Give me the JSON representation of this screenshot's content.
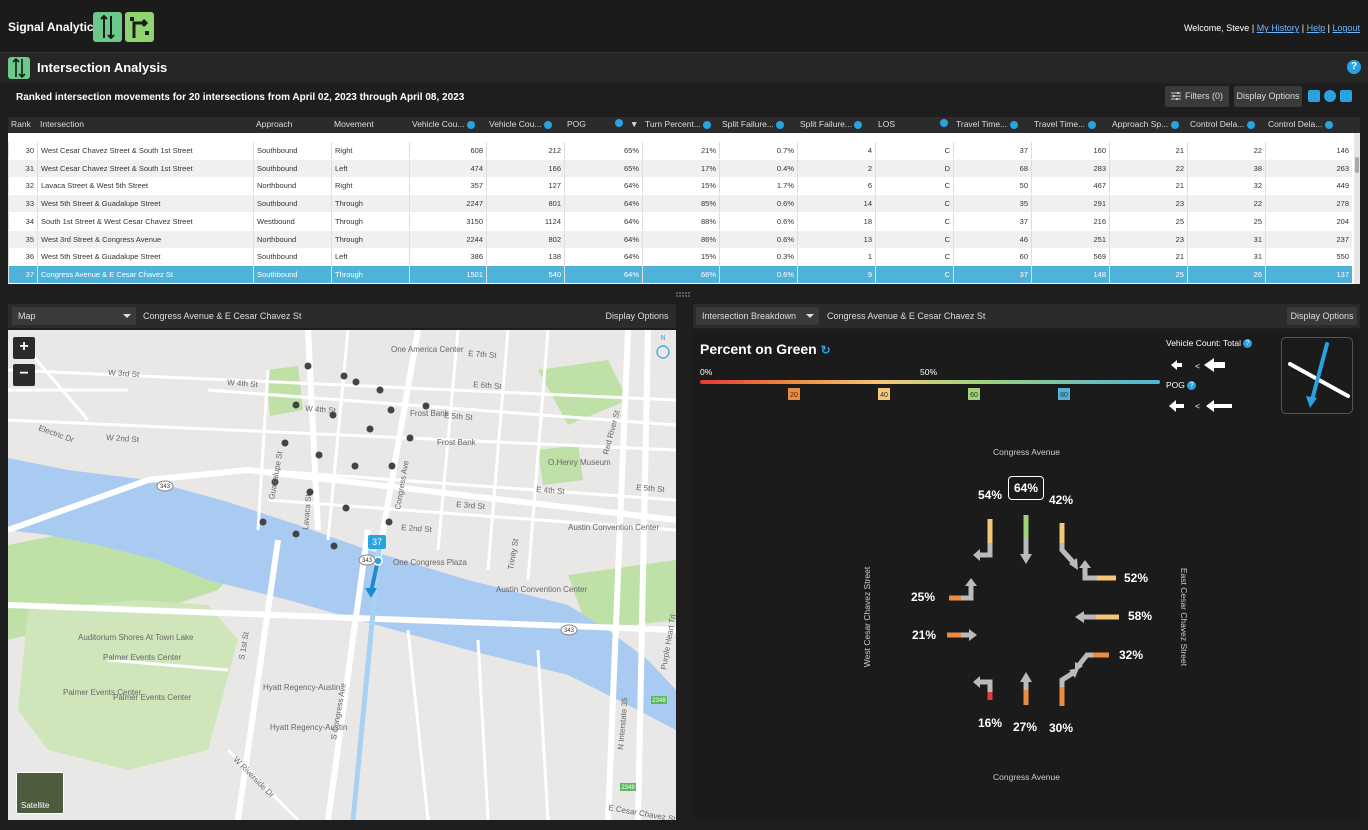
{
  "app": {
    "name": "Signal Analytics",
    "welcome": "Welcome, Steve",
    "links": [
      "My History",
      "Help",
      "Logout"
    ],
    "separator": "|"
  },
  "page": {
    "title": "Intersection Analysis",
    "help": "?",
    "summary": "Ranked intersection movements for 20 intersections from April 02, 2023 through April 08, 2023",
    "filters_label": "Filters (0)",
    "display_options_label": "Display Options"
  },
  "grid": {
    "columns": [
      "Rank",
      "Intersection",
      "Approach",
      "Movement",
      "Vehicle Cou...",
      "Vehicle Cou...",
      "POG",
      "Turn Percent...",
      "Split Failure...",
      "Split Failure...",
      "LOS",
      "Travel Time...",
      "Travel Time...",
      "Approach Sp...",
      "Control Dela...",
      "Control Dela..."
    ],
    "sort_indicator": "▼",
    "rows": [
      [
        "30",
        "West Cesar Chavez Street & South 1st Street",
        "Southbound",
        "Right",
        "608",
        "212",
        "65%",
        "21%",
        "0.7%",
        "4",
        "C",
        "37",
        "160",
        "21",
        "22",
        "146"
      ],
      [
        "31",
        "West Cesar Chavez Street & South 1st Street",
        "Southbound",
        "Left",
        "474",
        "166",
        "65%",
        "17%",
        "0.4%",
        "2",
        "D",
        "68",
        "283",
        "22",
        "38",
        "263"
      ],
      [
        "32",
        "Lavaca Street & West 5th Street",
        "Northbound",
        "Right",
        "357",
        "127",
        "64%",
        "15%",
        "1.7%",
        "6",
        "C",
        "50",
        "467",
        "21",
        "32",
        "449"
      ],
      [
        "33",
        "West 5th Street & Guadalupe Street",
        "Southbound",
        "Through",
        "2247",
        "801",
        "64%",
        "85%",
        "0.6%",
        "14",
        "C",
        "35",
        "291",
        "23",
        "22",
        "278"
      ],
      [
        "34",
        "South 1st Street & West Cesar Chavez Street",
        "Westbound",
        "Through",
        "3150",
        "1124",
        "64%",
        "88%",
        "0.6%",
        "18",
        "C",
        "37",
        "216",
        "25",
        "25",
        "204"
      ],
      [
        "35",
        "West 3rd Street & Congress Avenue",
        "Northbound",
        "Through",
        "2244",
        "802",
        "64%",
        "86%",
        "0.6%",
        "13",
        "C",
        "46",
        "251",
        "23",
        "31",
        "237"
      ],
      [
        "36",
        "West 5th Street & Guadalupe Street",
        "Southbound",
        "Left",
        "386",
        "138",
        "64%",
        "15%",
        "0.3%",
        "1",
        "C",
        "60",
        "569",
        "21",
        "31",
        "550"
      ],
      [
        "37",
        "Congress Avenue & E Cesar Chavez St",
        "Southbound",
        "Through",
        "1501",
        "540",
        "64%",
        "66%",
        "0.6%",
        "9",
        "C",
        "37",
        "148",
        "25",
        "26",
        "137"
      ]
    ],
    "selected_row_index": 7
  },
  "map_panel": {
    "view_select": "Map",
    "title": "Congress Avenue & E Cesar Chavez St",
    "display_options": "Display Options",
    "zoom_in": "+",
    "zoom_out": "−",
    "satellite": "Satellite",
    "marker_label": "37",
    "labels": {
      "one_america": "One America Center",
      "w3rd": "W 3rd St",
      "w4th": "W 4th St",
      "w4th2": "W 4th St",
      "e7th": "E 7th St",
      "e6th": "E 6th St",
      "e5th": "E 5th St",
      "e5th2": "E 5th St",
      "e4th": "E 4th St",
      "e3rd": "E 3rd St",
      "e2nd": "E 2nd St",
      "w2nd": "W 2nd St",
      "electric": "Electric Dr",
      "frost": "Frost Bank",
      "frost2": "Frost Bank",
      "ohenry": "O.Henry Museum",
      "redriver": "Red River St",
      "austin_conv": "Austin Convention Center",
      "austin_conv2": "Austin Convention Center",
      "one_congress": "One Congress Plaza",
      "trinity": "Trinity St",
      "congress": "Congress Ave",
      "s_congress": "S Congress Ave",
      "lavaca": "Lavaca St",
      "guadalupe": "Guadalupe St",
      "s1st": "S 1st St",
      "auditorium": "Auditorium Shores At Town Lake",
      "palmer": "Palmer Events Center",
      "palmer2": "Palmer Events Center",
      "palmer3": "Palmer Events Center",
      "hyatt": "Hyatt Regency-Austin",
      "hyatt2": "Hyatt Regency-Austin",
      "riverside": "W Riverside Dr",
      "interstate": "N Interstate 35",
      "purple_heart": "Purple Heart Trl",
      "e_cesar": "E Cesar Chavez St",
      "shield343a": "343",
      "shield343b": "343",
      "shield343c": "343",
      "shield2348a": "2348",
      "shield2348b": "2348",
      "n_label": "N"
    }
  },
  "breakdown_panel": {
    "view_select": "Intersection Breakdown",
    "title": "Congress Avenue & E Cesar Chavez St",
    "display_options": "Display Options",
    "metric_title": "Percent on Green",
    "scale_start": "0%",
    "scale_mid": "50%",
    "scale_ticks": [
      "20",
      "40",
      "60",
      "80"
    ],
    "vehicle_count_label": "Vehicle Count: Total",
    "pog_label": "POG",
    "less_than": "<",
    "street_north": "Congress Avenue",
    "street_south": "Congress Avenue",
    "street_west": "West Cesar Chavez Street",
    "street_east": "East Cesar Chavez Street",
    "pcts": {
      "sb_right": "54%",
      "sb_through": "64%",
      "sb_left": "42%",
      "wb_right": "52%",
      "wb_through": "58%",
      "wb_left": "32%",
      "eb_left": "25%",
      "eb_through": "21%",
      "nb_left": "16%",
      "nb_through": "27%",
      "nb_right": "30%"
    },
    "colors": {
      "sb_right": "#f5c77a",
      "sb_through": "#9fd37a",
      "sb_left": "#f5c77a",
      "wb_right": "#f5c77a",
      "wb_through": "#f5c77a",
      "wb_left": "#f08a3c",
      "eb_left": "#f08a3c",
      "eb_through": "#f08a3c",
      "nb_left": "#e23a3a",
      "nb_through": "#f08a3c",
      "nb_right": "#f08a3c"
    }
  },
  "colors": {
    "accent": "#29a3e0",
    "selected_row": "#4fb3d9",
    "logo_green": "#6cc98a"
  }
}
